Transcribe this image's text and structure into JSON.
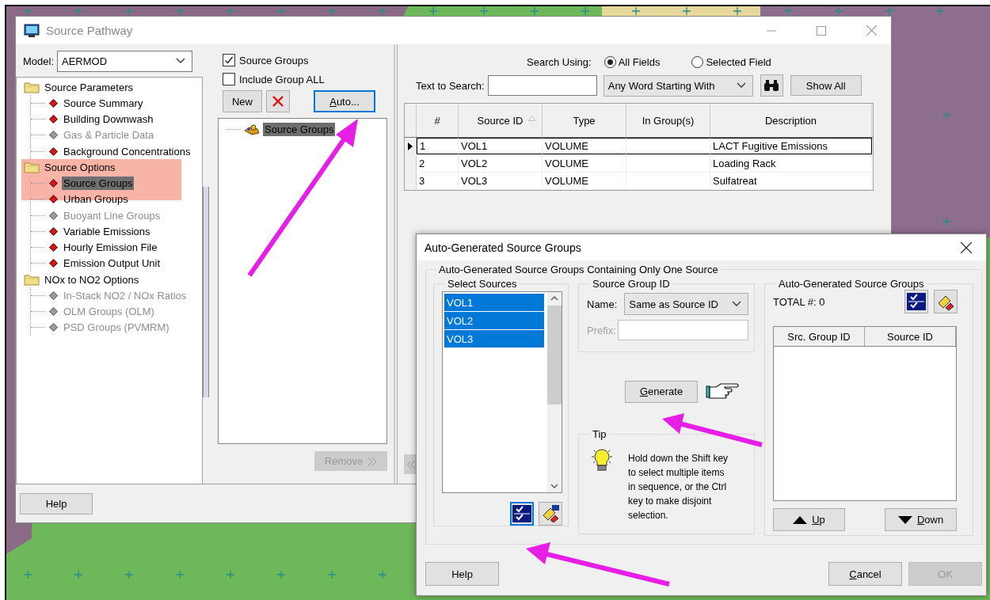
{
  "main_window": {
    "title": "Source Pathway",
    "model": {
      "label": "Model:",
      "value": "AERMOD"
    },
    "tree": [
      {
        "label": "Source Parameters",
        "highlighted": false,
        "children": [
          {
            "label": "Source Summary",
            "enabled": true,
            "selected": false
          },
          {
            "label": "Building Downwash",
            "enabled": true,
            "selected": false
          },
          {
            "label": "Gas & Particle Data",
            "enabled": false,
            "selected": false
          },
          {
            "label": "Background Concentrations",
            "enabled": true,
            "selected": false
          }
        ]
      },
      {
        "label": "Source Options",
        "highlighted": true,
        "children": [
          {
            "label": "Source Groups",
            "enabled": true,
            "selected": true
          },
          {
            "label": "Urban Groups",
            "enabled": true,
            "selected": false
          },
          {
            "label": "Buoyant Line Groups",
            "enabled": false,
            "selected": false
          },
          {
            "label": "Variable Emissions",
            "enabled": true,
            "selected": false
          },
          {
            "label": "Hourly Emission File",
            "enabled": true,
            "selected": false
          },
          {
            "label": "Emission Output Unit",
            "enabled": true,
            "selected": false
          }
        ]
      },
      {
        "label": "NOx to NO2 Options",
        "highlighted": false,
        "children": [
          {
            "label": "In-Stack NO2 / NOx Ratios",
            "enabled": false,
            "selected": false
          },
          {
            "label": "OLM Groups (OLM)",
            "enabled": false,
            "selected": false
          },
          {
            "label": "PSD Groups (PVMRM)",
            "enabled": false,
            "selected": false
          }
        ]
      }
    ],
    "groups_panel": {
      "checkboxes": [
        {
          "label": "Source Groups",
          "checked": true
        },
        {
          "label": "Include Group ALL",
          "checked": false
        }
      ],
      "new_button": "New",
      "auto_button": {
        "label": "Auto...",
        "mnemonic": true,
        "focused": true
      },
      "group_tree": [
        {
          "label": "Source Groups",
          "selected": true
        }
      ],
      "remove_button": {
        "label": "Remove",
        "disabled": true
      }
    },
    "search": {
      "label": "Search Using:",
      "options": [
        {
          "label": "All Fields",
          "selected": true
        },
        {
          "label": "Selected Field",
          "selected": false
        }
      ],
      "text_label": "Text to Search:",
      "match_mode": "Any Word Starting With",
      "show_all_button": "Show All"
    },
    "table": {
      "columns": [
        {
          "label": "#",
          "sorted": false
        },
        {
          "label": "Source ID",
          "sorted": true
        },
        {
          "label": "Type",
          "sorted": false
        },
        {
          "label": "In Group(s)",
          "sorted": false
        },
        {
          "label": "Description",
          "sorted": false
        }
      ],
      "rows": [
        {
          "number": "1",
          "source_id": "VOL1",
          "type": "VOLUME",
          "description": "LACT Fugitive Emissions",
          "selected": true
        },
        {
          "number": "2",
          "source_id": "VOL2",
          "type": "VOLUME",
          "description": "Loading Rack",
          "selected": false
        },
        {
          "number": "3",
          "source_id": "VOL3",
          "type": "VOLUME",
          "description": "Sulfatreat",
          "selected": false
        }
      ]
    },
    "help_button": "Help"
  },
  "dialog": {
    "title": "Auto-Generated Source Groups",
    "group_title": "Auto-Generated Source Groups Containing Only One Source",
    "select_sources": {
      "title": "Select Sources",
      "items": [
        {
          "label": "VOL1",
          "selected": true
        },
        {
          "label": "VOL2",
          "selected": true
        },
        {
          "label": "VOL3",
          "selected": true
        }
      ]
    },
    "source_group_id": {
      "title": "Source Group ID",
      "name_label": "Name:",
      "name_value": "Same as Source ID",
      "prefix_label": "Prefix:",
      "prefix_enabled": false
    },
    "generate_button": {
      "label": "Generate",
      "mnemonic": true
    },
    "tip": {
      "title": "Tip",
      "text": "Hold down the Shift key to select multiple items in sequence, or the Ctrl key to make disjoint selection."
    },
    "results": {
      "title": "Auto-Generated Source Groups",
      "total": "TOTAL #: 0",
      "columns": [
        "Src. Group ID",
        "Source ID"
      ],
      "up_button": {
        "label": "Up",
        "mnemonic": true
      },
      "down_button": {
        "label": "Down",
        "mnemonic": true
      }
    },
    "buttons": [
      {
        "label": "Help",
        "mnemonic": false,
        "disabled": false
      },
      {
        "label": "Cancel",
        "mnemonic": true,
        "disabled": false
      },
      {
        "label": "OK",
        "mnemonic": false,
        "disabled": true
      }
    ]
  }
}
